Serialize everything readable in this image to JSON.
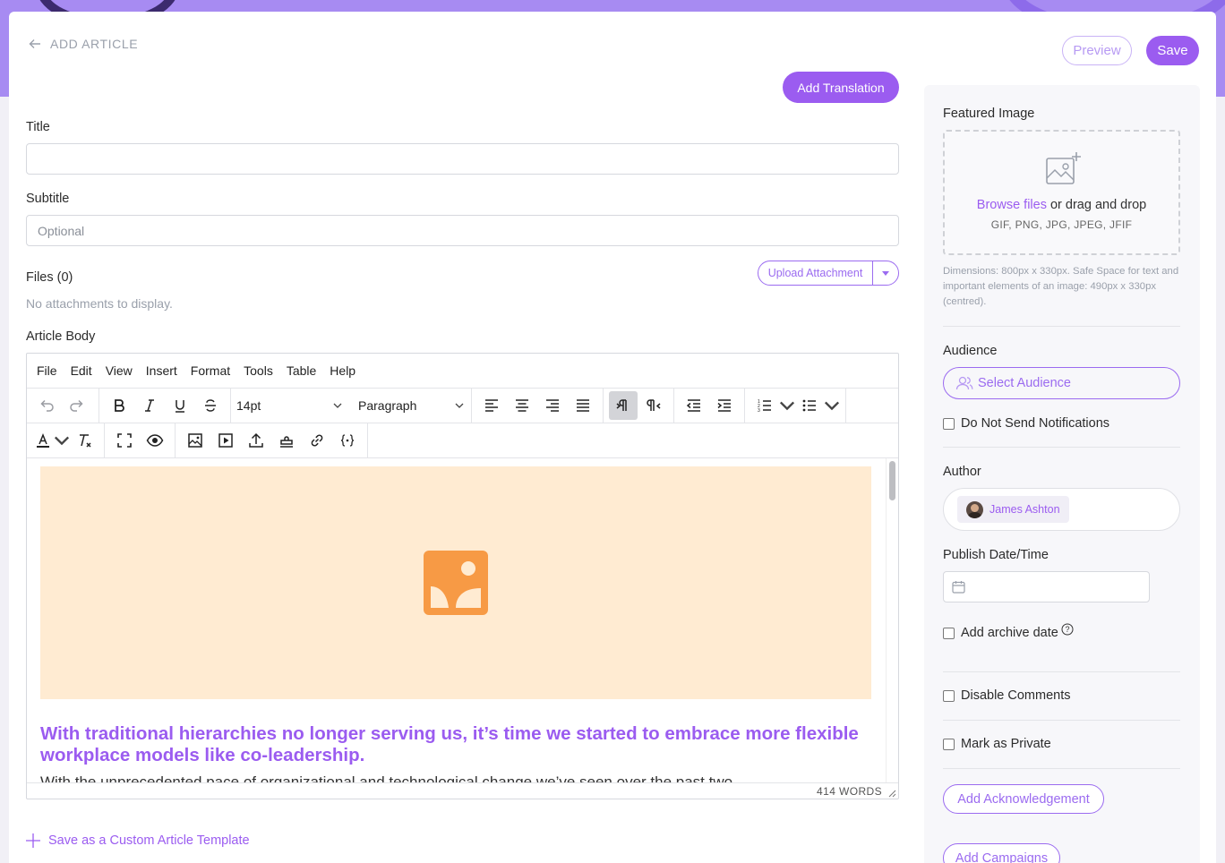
{
  "header": {
    "back_label": "ADD ARTICLE",
    "preview_label": "Preview",
    "save_label": "Save",
    "add_translation_label": "Add Translation"
  },
  "form": {
    "title_label": "Title",
    "title_value": "",
    "subtitle_label": "Subtitle",
    "subtitle_placeholder": "Optional",
    "files_label": "Files (0)",
    "no_attachments": "No attachments to display.",
    "upload_label": "Upload Attachment",
    "article_body_label": "Article Body"
  },
  "editor": {
    "menu": [
      "File",
      "Edit",
      "View",
      "Insert",
      "Format",
      "Tools",
      "Table",
      "Help"
    ],
    "font_size": "14pt",
    "block_format": "Paragraph",
    "headline": "With traditional hierarchies no longer serving us, it’s time we started to embrace more flexible workplace models like co-leadership.",
    "body_partial": "With the unprecedented pace of organizational and technological change we’ve seen over the past two",
    "word_count": "414 WORDS"
  },
  "footer": {
    "custom_template_label": "Save as a Custom Article Template"
  },
  "sidebar": {
    "featured_image_label": "Featured Image",
    "browse_files": "Browse files",
    "drag_drop": " or drag and drop",
    "file_types": "GIF, PNG, JPG, JPEG, JFIF",
    "dimensions_note": "Dimensions: 800px x 330px. Safe Space for text and important elements of an image: 490px x 330px (centred).",
    "audience_label": "Audience",
    "select_audience": "Select Audience",
    "do_not_send": "Do Not Send Notifications",
    "author_label": "Author",
    "author_name": "James Ashton",
    "publish_label": "Publish Date/Time",
    "publish_value": "",
    "archive_label": "Add archive date",
    "disable_comments": "Disable Comments",
    "mark_private": "Mark as Private",
    "add_ack": "Add Acknowledgement",
    "add_campaigns": "Add Campaigns"
  },
  "colors": {
    "accent": "#9b5cf0",
    "banner": "#a78bf2",
    "image_placeholder_bg": "#ffebd2",
    "image_placeholder_icon": "#f79a45"
  }
}
